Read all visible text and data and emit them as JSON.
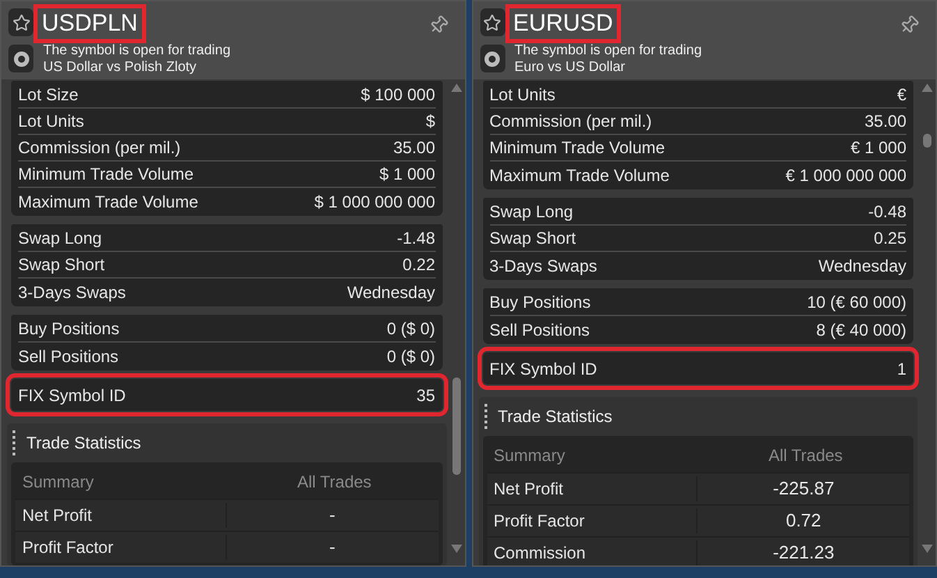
{
  "panels": [
    {
      "symbol": "USDPLN",
      "symbol_highlighted": true,
      "status": "The symbol is open for trading",
      "description": "US Dollar vs Polish Zloty",
      "groups": [
        [
          {
            "label": "Lot Size",
            "value": "$ 100 000"
          },
          {
            "label": "Lot Units",
            "value": "$"
          },
          {
            "label": "Commission (per mil.)",
            "value": "35.00"
          },
          {
            "label": "Minimum Trade Volume",
            "value": "$ 1 000"
          },
          {
            "label": "Maximum Trade Volume",
            "value": "$ 1 000 000 000"
          }
        ],
        [
          {
            "label": "Swap Long",
            "value": "-1.48"
          },
          {
            "label": "Swap Short",
            "value": "0.22"
          },
          {
            "label": "3-Days Swaps",
            "value": "Wednesday"
          }
        ],
        [
          {
            "label": "Buy Positions",
            "value": "0 ($ 0)"
          },
          {
            "label": "Sell Positions",
            "value": "0 ($ 0)"
          }
        ]
      ],
      "fix": {
        "label": "FIX Symbol ID",
        "value": "35",
        "highlighted": true
      },
      "stats": {
        "title": "Trade Statistics",
        "columns": [
          "Summary",
          "All Trades"
        ],
        "rows": [
          {
            "label": "Net Profit",
            "value": "-"
          },
          {
            "label": "Profit Factor",
            "value": "-"
          }
        ]
      }
    },
    {
      "symbol": "EURUSD",
      "symbol_highlighted": true,
      "status": "The symbol is open for trading",
      "description": "Euro vs US Dollar",
      "groups": [
        [
          {
            "label": "Lot Units",
            "value": "€"
          },
          {
            "label": "Commission (per mil.)",
            "value": "35.00"
          },
          {
            "label": "Minimum Trade Volume",
            "value": "€ 1 000"
          },
          {
            "label": "Maximum Trade Volume",
            "value": "€ 1 000 000 000"
          }
        ],
        [
          {
            "label": "Swap Long",
            "value": "-0.48"
          },
          {
            "label": "Swap Short",
            "value": "0.25"
          },
          {
            "label": "3-Days Swaps",
            "value": "Wednesday"
          }
        ],
        [
          {
            "label": "Buy Positions",
            "value": "10 (€ 60 000)"
          },
          {
            "label": "Sell Positions",
            "value": "8 (€ 40 000)"
          }
        ]
      ],
      "fix": {
        "label": "FIX Symbol ID",
        "value": "1",
        "highlighted": true
      },
      "stats": {
        "title": "Trade Statistics",
        "columns": [
          "Summary",
          "All Trades"
        ],
        "rows": [
          {
            "label": "Net Profit",
            "value": "-225.87"
          },
          {
            "label": "Profit Factor",
            "value": "0.72"
          },
          {
            "label": "Commission",
            "value": "-221.23"
          }
        ]
      }
    }
  ]
}
